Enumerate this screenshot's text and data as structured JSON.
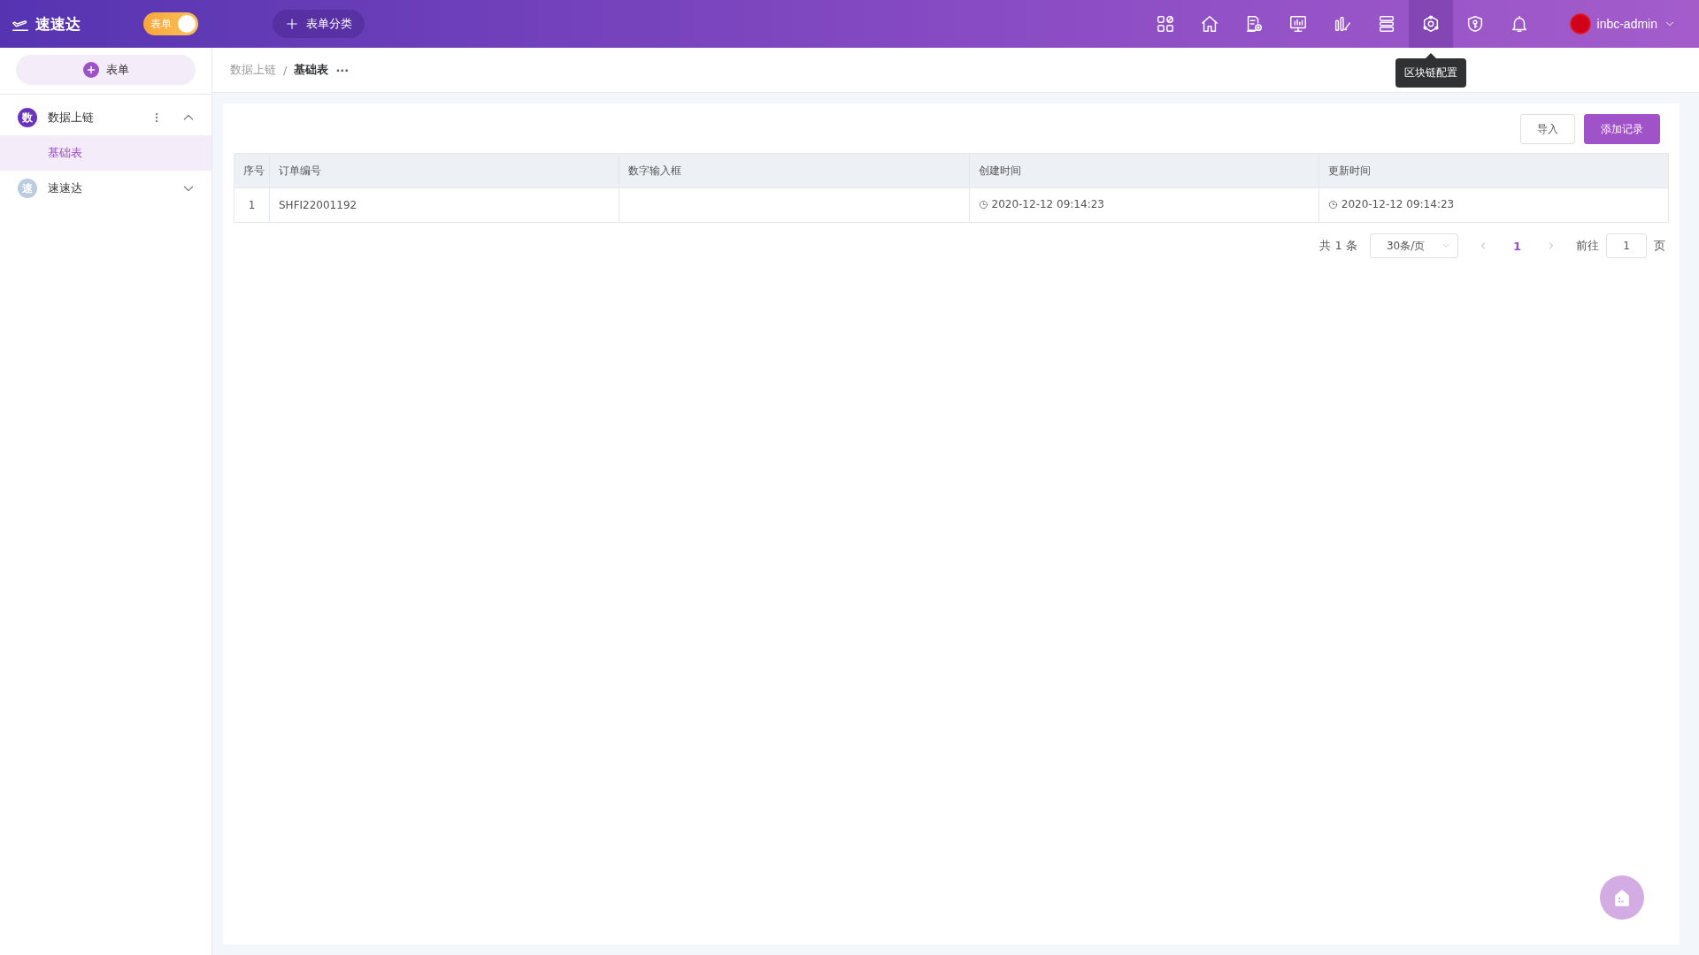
{
  "header": {
    "logo": "速速达",
    "mode_switch": {
      "label": "表单",
      "on": true
    },
    "category_button": "表单分类",
    "toolbar": [
      {
        "active": false
      },
      {
        "active": false
      },
      {
        "active": false
      },
      {
        "active": false
      },
      {
        "active": false
      },
      {
        "active": false
      },
      {
        "active": true,
        "tooltip": "区块链配置"
      },
      {
        "active": false
      },
      {
        "active": false
      }
    ],
    "user": "inbc-admin"
  },
  "sidebar": {
    "new_button": "表单",
    "groups": [
      {
        "badge": "数",
        "label": "数据上链",
        "expanded": true,
        "color": "#6a35bd",
        "children": [
          {
            "label": "基础表",
            "selected": true
          }
        ]
      },
      {
        "badge": "速",
        "label": "速速达",
        "expanded": false,
        "color": "#bccbe0"
      }
    ]
  },
  "breadcrumb": {
    "items": [
      "数据上链",
      "基础表"
    ],
    "separator": "/",
    "more": "···"
  },
  "actions": [
    {
      "label": "导入",
      "kind": "plain"
    },
    {
      "label": "添加记录",
      "kind": "primary"
    }
  ],
  "table": {
    "columns": [
      "序号",
      "订单编号",
      "数字输入框",
      "创建时间",
      "更新时间"
    ],
    "rows": [
      {
        "index": "1",
        "order_no": "SHFI22001192",
        "created": "2020-12-12 09:14:23",
        "updated": "2020-12-12 09:14:23"
      }
    ]
  },
  "pagination": {
    "total": "共 1 条",
    "page_size": "30条/页",
    "pages": [
      {
        "label": "1",
        "selected": true
      }
    ],
    "goto_label": "前往",
    "goto_value": "1",
    "page_suffix": "页"
  }
}
